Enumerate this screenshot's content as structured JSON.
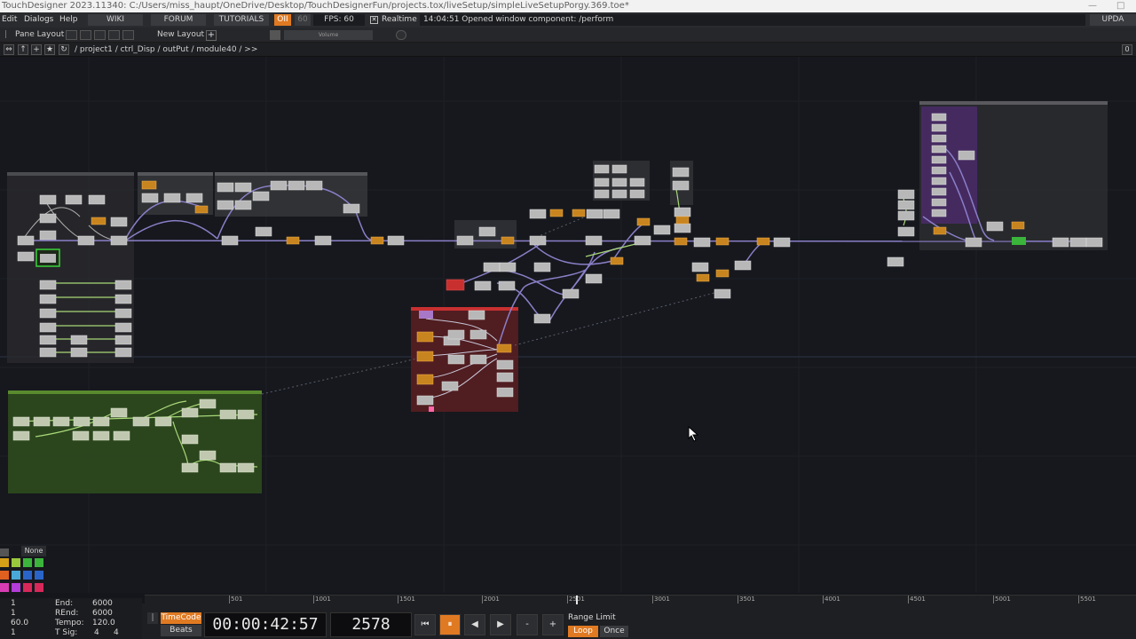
{
  "window": {
    "title": "TouchDesigner 2023.11340: C:/Users/miss_haupt/OneDrive/Desktop/TouchDesignerFun/projects.tox/liveSetup/simpleLiveSetupPorgy.369.toe*"
  },
  "menubar": {
    "items": [
      "Edit",
      "Dialogs",
      "Help"
    ],
    "buttons": [
      "WIKI",
      "FORUM",
      "TUTORIALS"
    ],
    "oii_label": "OII",
    "fps_target": "60",
    "fps_label": "FPS:",
    "fps_value": "60",
    "realtime_label": "Realtime",
    "realtime_checked": true,
    "status_message": "14:04:51 Opened window component: /perform",
    "update_label": "UPDA"
  },
  "panebar": {
    "pane_layout_label": "Pane Layout",
    "new_layout_label": "New Layout",
    "volume_label": "Volume"
  },
  "pathbar": {
    "path": "/ project1 / ctrl_Disp / outPut / module40 / >>",
    "right_value": "0"
  },
  "palette": {
    "none_label": "None",
    "colors": [
      "#d4a017",
      "#9ac83c",
      "#3cb43c",
      "#e06020",
      "#4aa8d8",
      "#2a64c8",
      "#d83cb4",
      "#b43cd8",
      "#d8285a"
    ]
  },
  "range": {
    "start_value": "1",
    "rstart_value": "1",
    "rate_value": "60.0",
    "tsig_value_a": "1",
    "end_label": "End:",
    "end_value": "6000",
    "rend_label": "REnd:",
    "rend_value": "6000",
    "tempo_label": "Tempo:",
    "tempo_value": "120.0",
    "tsig_label": "T Sig:",
    "tsig_num": "4",
    "tsig_den": "4"
  },
  "timeline": {
    "ticks": [
      "501",
      "1001",
      "1501",
      "2001",
      "2501",
      "3001",
      "3501",
      "4001",
      "4501",
      "5001",
      "5501"
    ],
    "timecode_label": "TimeCode",
    "beats_label": "Beats",
    "timecode_value": "00:00:42:57",
    "frame_value": "2578",
    "range_limit_label": "Range Limit",
    "loop_label": "Loop",
    "once_label": "Once",
    "buttons": [
      "⏮",
      "⏸",
      "◀",
      "▶",
      "-",
      "+"
    ]
  }
}
